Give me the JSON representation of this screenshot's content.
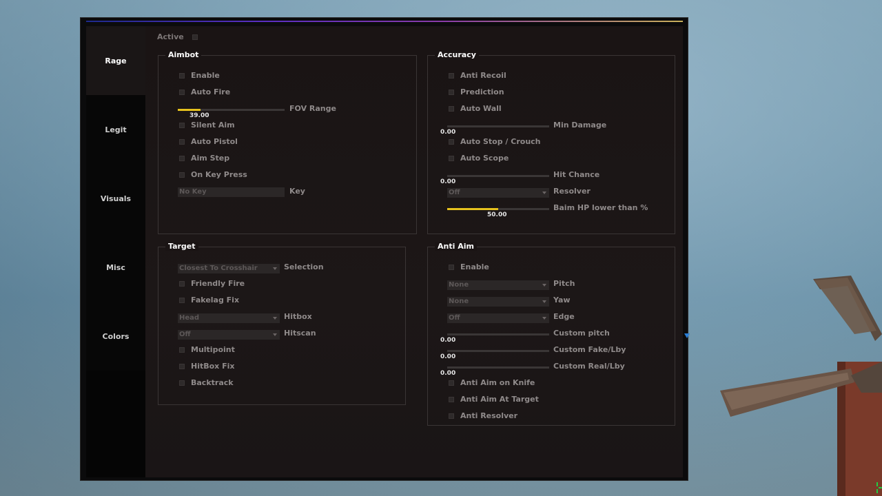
{
  "sidebar": {
    "tabs": [
      {
        "label": "Rage"
      },
      {
        "label": "Legit"
      },
      {
        "label": "Visuals"
      },
      {
        "label": "Misc"
      },
      {
        "label": "Colors"
      }
    ]
  },
  "header": {
    "active_label": "Active"
  },
  "aimbot": {
    "title": "Aimbot",
    "enable": "Enable",
    "auto_fire": "Auto Fire",
    "fov_range_label": "FOV Range",
    "fov_range_value": "39.00",
    "fov_range_fraction": 0.21,
    "silent_aim": "Silent Aim",
    "auto_pistol": "Auto Pistol",
    "aim_step": "Aim Step",
    "on_key_press": "On Key Press",
    "key_value": "No Key",
    "key_label": "Key"
  },
  "accuracy": {
    "title": "Accuracy",
    "anti_recoil": "Anti Recoil",
    "prediction": "Prediction",
    "auto_wall": "Auto Wall",
    "min_damage_label": "Min Damage",
    "min_damage_value": "0.00",
    "auto_stop": "Auto Stop / Crouch",
    "auto_scope": "Auto Scope",
    "hit_chance_label": "Hit Chance",
    "hit_chance_value": "0.00",
    "resolver_value": "Off",
    "resolver_label": "Resolver",
    "baim_label": "Baim HP lower than %",
    "baim_value": "50.00",
    "baim_fraction": 0.5
  },
  "target": {
    "title": "Target",
    "selection_value": "Closest To Crosshair",
    "selection_label": "Selection",
    "friendly_fire": "Friendly Fire",
    "fakelag_fix": "Fakelag Fix",
    "hitbox_value": "Head",
    "hitbox_label": "Hitbox",
    "hitscan_value": "Off",
    "hitscan_label": "Hitscan",
    "multipoint": "Multipoint",
    "hitbox_fix": "HitBox Fix",
    "backtrack": "Backtrack"
  },
  "anti_aim": {
    "title": "Anti Aim",
    "enable": "Enable",
    "pitch_value": "None",
    "pitch_label": "Pitch",
    "yaw_value": "None",
    "yaw_label": "Yaw",
    "edge_value": "Off",
    "edge_label": "Edge",
    "custom_pitch_label": "Custom pitch",
    "custom_pitch_value": "0.00",
    "custom_fake_label": "Custom Fake/Lby",
    "custom_fake_value": "0.00",
    "custom_real_label": "Custom Real/Lby",
    "custom_real_value": "0.00",
    "anti_aim_knife": "Anti Aim on Knife",
    "anti_aim_target": "Anti Aim At Target",
    "anti_resolver": "Anti Resolver"
  },
  "colors": {
    "accent": "#e6c21e",
    "cursor": "#2a7ed6",
    "crosshair": "#22cc44"
  }
}
